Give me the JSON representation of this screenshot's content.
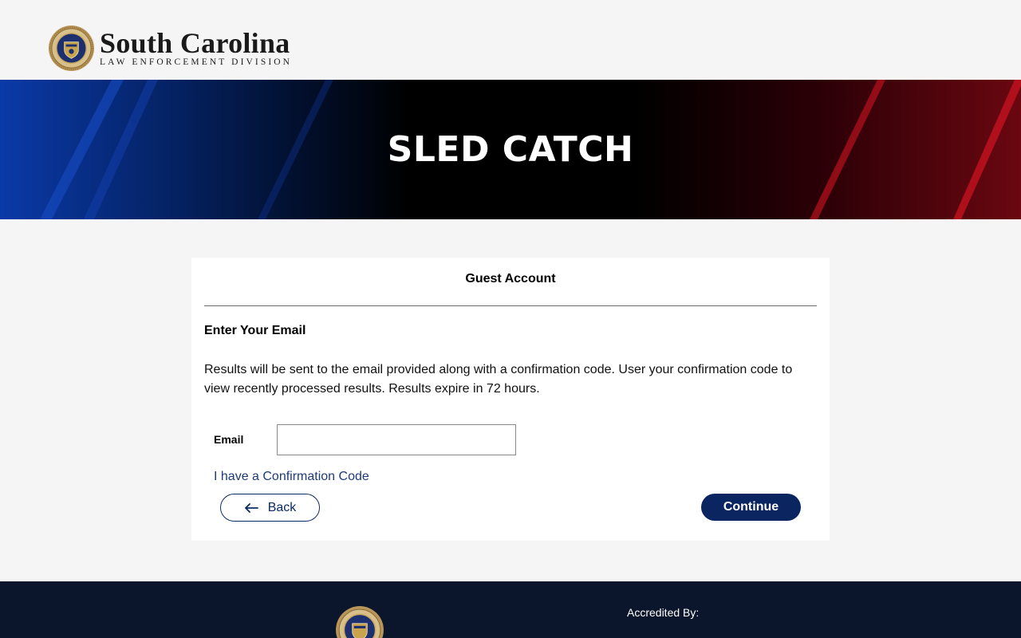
{
  "header": {
    "logo_title": "South Carolina",
    "logo_subtitle": "LAW ENFORCEMENT DIVISION",
    "seal_text": "SLED"
  },
  "banner": {
    "title": "SLED CATCH"
  },
  "card": {
    "title": "Guest Account",
    "section_title": "Enter Your Email",
    "info_text": "Results will be sent to the email provided along with a confirmation code. User your confirmation code to view recently processed results. Results expire in 72 hours.",
    "email_label": "Email",
    "email_value": "",
    "confirmation_link": "I have a Confirmation Code",
    "back_label": "Back",
    "continue_label": "Continue"
  },
  "footer": {
    "accredited_label": "Accredited By:"
  },
  "colors": {
    "navy": "#0a2560",
    "link": "#1d3b7a",
    "footer_bg": "#0b152b"
  }
}
